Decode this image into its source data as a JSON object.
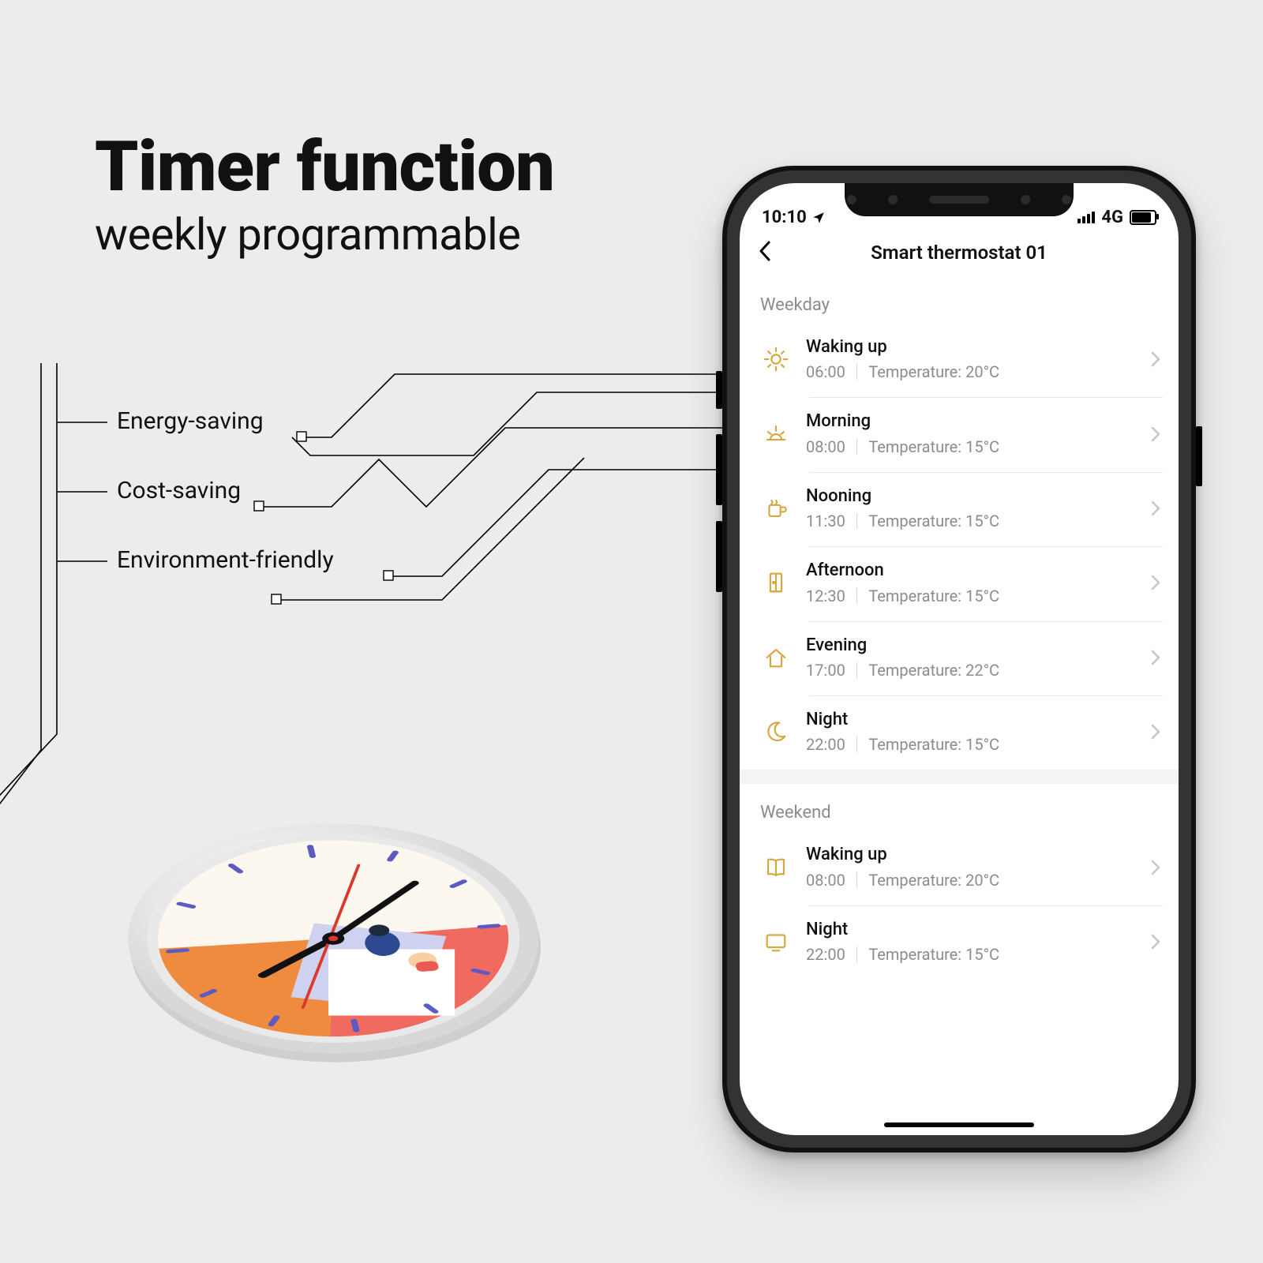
{
  "headline": {
    "title": "Timer function",
    "subtitle": "weekly programmable"
  },
  "features": [
    "Energy-saving",
    "Cost-saving",
    "Environment-friendly"
  ],
  "phone": {
    "status": {
      "time": "10:10",
      "network": "4G"
    },
    "title": "Smart thermostat 01",
    "sections": [
      {
        "title": "Weekday",
        "items": [
          {
            "icon": "sun",
            "label": "Waking up",
            "time": "06:00",
            "temp": "Temperature: 20°C"
          },
          {
            "icon": "sunrise",
            "label": "Morning",
            "time": "08:00",
            "temp": "Temperature: 15°C"
          },
          {
            "icon": "mug",
            "label": "Nooning",
            "time": "11:30",
            "temp": "Temperature: 15°C"
          },
          {
            "icon": "door",
            "label": "Afternoon",
            "time": "12:30",
            "temp": "Temperature: 15°C"
          },
          {
            "icon": "home",
            "label": "Evening",
            "time": "17:00",
            "temp": "Temperature: 22°C"
          },
          {
            "icon": "moon",
            "label": "Night",
            "time": "22:00",
            "temp": "Temperature: 15°C"
          }
        ]
      },
      {
        "title": "Weekend",
        "items": [
          {
            "icon": "book",
            "label": "Waking up",
            "time": "08:00",
            "temp": "Temperature: 20°C"
          },
          {
            "icon": "tv",
            "label": "Night",
            "time": "22:00",
            "temp": "Temperature: 15°C"
          }
        ]
      }
    ]
  }
}
